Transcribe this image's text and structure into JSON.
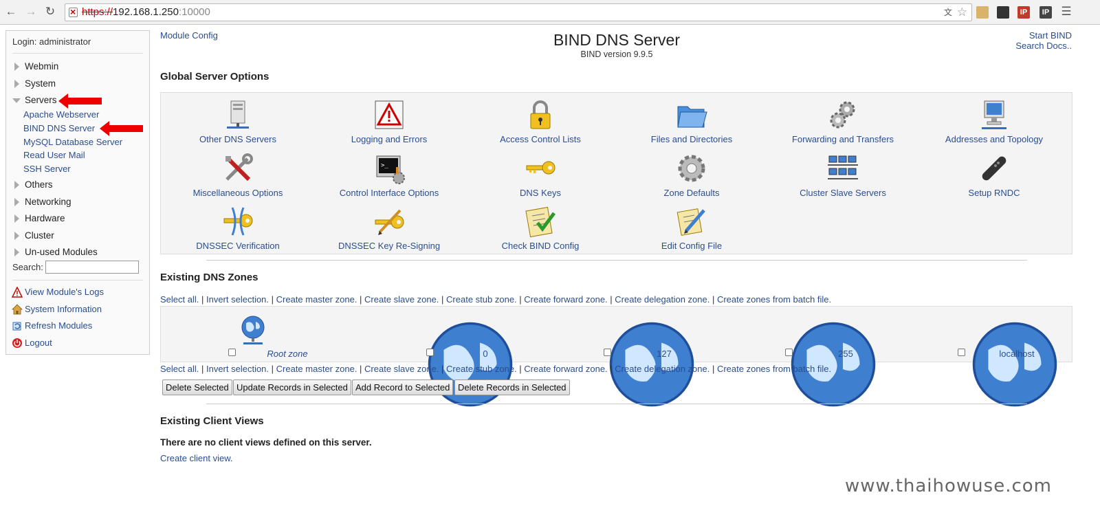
{
  "browser": {
    "url_scheme": "https://",
    "url_host": "192.168.1.250",
    "url_port": ":10000"
  },
  "sidebar": {
    "login": "Login: administrator",
    "categories": [
      {
        "label": "Webmin"
      },
      {
        "label": "System"
      },
      {
        "label": "Servers"
      },
      {
        "label": "Others"
      },
      {
        "label": "Networking"
      },
      {
        "label": "Hardware"
      },
      {
        "label": "Cluster"
      },
      {
        "label": "Un-used Modules"
      }
    ],
    "servers_items": [
      {
        "label": "Apache Webserver"
      },
      {
        "label": "BIND DNS Server"
      },
      {
        "label": "MySQL Database Server"
      },
      {
        "label": "Read User Mail"
      },
      {
        "label": "SSH Server"
      }
    ],
    "search_label": "Search:",
    "utilities": [
      {
        "label": "View Module's Logs"
      },
      {
        "label": "System Information"
      },
      {
        "label": "Refresh Modules"
      },
      {
        "label": "Logout"
      }
    ]
  },
  "header": {
    "module_config": "Module Config",
    "title": "BIND DNS Server",
    "version": "BIND version 9.9.5",
    "start_bind": "Start BIND",
    "search_docs": "Search Docs.."
  },
  "global_options": {
    "title": "Global Server Options",
    "items": [
      {
        "label": "Other DNS Servers",
        "icon": "server-icon"
      },
      {
        "label": "Logging and Errors",
        "icon": "warning-icon"
      },
      {
        "label": "Access Control Lists",
        "icon": "lock-icon"
      },
      {
        "label": "Files and Directories",
        "icon": "folder-icon"
      },
      {
        "label": "Forwarding and Transfers",
        "icon": "gears-icon"
      },
      {
        "label": "Addresses and Topology",
        "icon": "computer-icon"
      },
      {
        "label": "Miscellaneous Options",
        "icon": "tools-icon"
      },
      {
        "label": "Control Interface Options",
        "icon": "terminal-icon"
      },
      {
        "label": "DNS Keys",
        "icon": "key-icon"
      },
      {
        "label": "Zone Defaults",
        "icon": "gear-icon"
      },
      {
        "label": "Cluster Slave Servers",
        "icon": "cluster-icon"
      },
      {
        "label": "Setup RNDC",
        "icon": "remote-icon"
      },
      {
        "label": "DNSSEC Verification",
        "icon": "key-verify-icon"
      },
      {
        "label": "DNSSEC Key Re-Signing",
        "icon": "key-sign-icon"
      },
      {
        "label": "Check BIND Config",
        "icon": "checklist-icon"
      },
      {
        "label": "Edit Config File",
        "icon": "edit-icon"
      }
    ]
  },
  "zones": {
    "title": "Existing DNS Zones",
    "actions": [
      "Select all.",
      "Invert selection.",
      "Create master zone.",
      "Create slave zone.",
      "Create stub zone.",
      "Create forward zone.",
      "Create delegation zone.",
      "Create zones from batch file."
    ],
    "items": [
      {
        "label": "Root zone",
        "icon": "globe-network-icon"
      },
      {
        "label": "0",
        "icon": "globe-icon"
      },
      {
        "label": "127",
        "icon": "globe-icon"
      },
      {
        "label": "255",
        "icon": "globe-icon"
      },
      {
        "label": "localhost",
        "icon": "globe-icon"
      }
    ],
    "buttons": [
      "Delete Selected",
      "Update Records in Selected",
      "Add Record to Selected",
      "Delete Records in Selected"
    ]
  },
  "client_views": {
    "title": "Existing Client Views",
    "empty_text": "There are no client views defined on this server.",
    "create_link": "Create client view."
  },
  "watermark": "www.thaihowuse.com"
}
